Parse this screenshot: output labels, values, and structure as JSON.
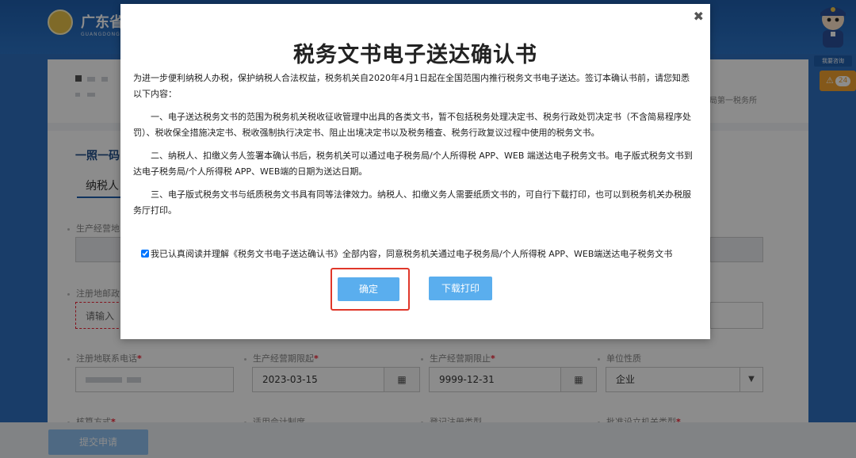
{
  "header": {
    "brand": "广东省",
    "brand_sub": "GUANGDONG EL"
  },
  "right_panel": {
    "consult_label": "我要咨询",
    "alert_count": "24",
    "alert_icon": "warning-icon"
  },
  "info_card": {
    "office": "局第一税务所"
  },
  "form": {
    "section_title": "一照一码",
    "tab_label": "纳税人",
    "fields": {
      "production_address": {
        "label": "生产经营地"
      },
      "registered_postcode": {
        "label": "注册地邮政",
        "placeholder": "请输入"
      },
      "registered_phone": {
        "label": "注册地联系电话"
      },
      "period_start": {
        "label": "生产经营期限起",
        "value": "2023-03-15"
      },
      "period_end": {
        "label": "生产经营期限止",
        "value": "9999-12-31"
      },
      "unit_nature": {
        "label": "单位性质",
        "value": "企业"
      },
      "verification_method": {
        "label": "核算方式"
      },
      "accounting_system": {
        "label": "适用会计制度"
      },
      "registration_type": {
        "label": "登记注册类型"
      },
      "approval_authority": {
        "label": "批准设立机关类型"
      }
    },
    "submit_label": "提交申请"
  },
  "modal": {
    "close_glyph": "✖",
    "title": "税务文书电子送达确认书",
    "intro": "为进一步便利纳税人办税，保护纳税人合法权益，税务机关自2020年4月1日起在全国范围内推行税务文书电子送达。签订本确认书前，请您知悉以下内容：",
    "item1": "一、电子送达税务文书的范围为税务机关税收征收管理中出具的各类文书，暂不包括税务处理决定书、税务行政处罚决定书（不含简易程序处罚）、税收保全措施决定书、税收强制执行决定书、阻止出境决定书以及税务稽查、税务行政复议过程中使用的税务文书。",
    "item2": "二、纳税人、扣缴义务人签署本确认书后，税务机关可以通过电子税务局/个人所得税 APP、WEB 端送达电子税务文书。电子版式税务文书到达电子税务局/个人所得税 APP、WEB端的日期为送达日期。",
    "item3": "三、电子版式税务文书与纸质税务文书具有同等法律效力。纳税人、扣缴义务人需要纸质文书的，可自行下载打印，也可以到税务机关办税服务厅打印。",
    "agree_text": "我已认真阅读并理解《税务文书电子送达确认书》全部内容，同意税务机关通过电子税务局/个人所得税 APP、WEB端送达电子税务文书",
    "agree_checked": true,
    "confirm_label": "确定",
    "download_label": "下载打印"
  }
}
